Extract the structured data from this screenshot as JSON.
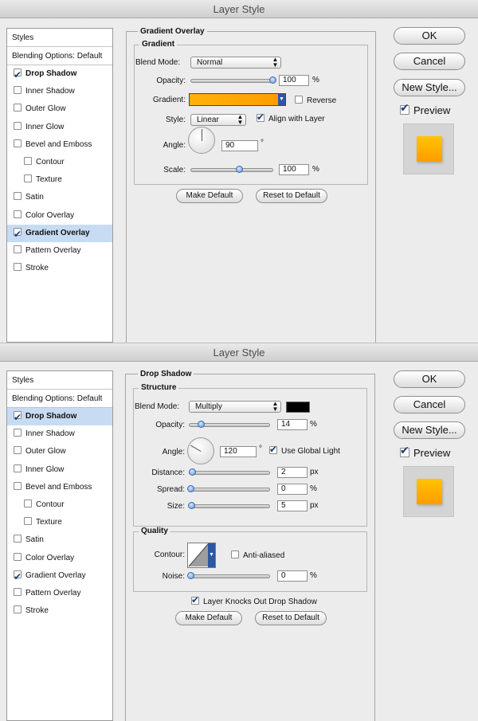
{
  "dialog1": {
    "title": "Layer Style",
    "styles_header": "Styles",
    "blending_options": "Blending Options: Default",
    "items": [
      {
        "label": "Drop Shadow",
        "checked": true
      },
      {
        "label": "Inner Shadow",
        "checked": false
      },
      {
        "label": "Outer Glow",
        "checked": false
      },
      {
        "label": "Inner Glow",
        "checked": false
      },
      {
        "label": "Bevel and Emboss",
        "checked": false
      },
      {
        "label": "Contour",
        "checked": false
      },
      {
        "label": "Texture",
        "checked": false
      },
      {
        "label": "Satin",
        "checked": false
      },
      {
        "label": "Color Overlay",
        "checked": false
      },
      {
        "label": "Gradient Overlay",
        "checked": true
      },
      {
        "label": "Pattern Overlay",
        "checked": false
      },
      {
        "label": "Stroke",
        "checked": false
      }
    ],
    "buttons": {
      "ok": "OK",
      "cancel": "Cancel",
      "new_style": "New Style...",
      "preview": "Preview"
    },
    "panel": {
      "section_title": "Gradient Overlay",
      "group_title": "Gradient",
      "blend_mode_label": "Blend Mode:",
      "blend_mode_value": "Normal",
      "opacity_label": "Opacity:",
      "opacity_value": "100",
      "opacity_unit": "%",
      "gradient_label": "Gradient:",
      "reverse_label": "Reverse",
      "style_label": "Style:",
      "style_value": "Linear",
      "align_label": "Align with Layer",
      "angle_label": "Angle:",
      "angle_value": "90",
      "angle_unit": "°",
      "scale_label": "Scale:",
      "scale_value": "100",
      "scale_unit": "%",
      "make_default": "Make Default",
      "reset_default": "Reset to Default"
    }
  },
  "dialog2": {
    "title": "Layer Style",
    "styles_header": "Styles",
    "blending_options": "Blending Options: Default",
    "items": [
      {
        "label": "Drop Shadow",
        "checked": true
      },
      {
        "label": "Inner Shadow",
        "checked": false
      },
      {
        "label": "Outer Glow",
        "checked": false
      },
      {
        "label": "Inner Glow",
        "checked": false
      },
      {
        "label": "Bevel and Emboss",
        "checked": false
      },
      {
        "label": "Contour",
        "checked": false
      },
      {
        "label": "Texture",
        "checked": false
      },
      {
        "label": "Satin",
        "checked": false
      },
      {
        "label": "Color Overlay",
        "checked": false
      },
      {
        "label": "Gradient Overlay",
        "checked": true
      },
      {
        "label": "Pattern Overlay",
        "checked": false
      },
      {
        "label": "Stroke",
        "checked": false
      }
    ],
    "buttons": {
      "ok": "OK",
      "cancel": "Cancel",
      "new_style": "New Style...",
      "preview": "Preview"
    },
    "panel": {
      "section_title": "Drop Shadow",
      "group_title": "Structure",
      "blend_mode_label": "Blend Mode:",
      "blend_mode_value": "Multiply",
      "opacity_label": "Opacity:",
      "opacity_value": "14",
      "opacity_unit": "%",
      "angle_label": "Angle:",
      "angle_value": "120",
      "angle_unit": "°",
      "global_light_label": "Use Global Light",
      "distance_label": "Distance:",
      "distance_value": "2",
      "distance_unit": "px",
      "spread_label": "Spread:",
      "spread_value": "0",
      "spread_unit": "%",
      "size_label": "Size:",
      "size_value": "5",
      "size_unit": "px",
      "quality_title": "Quality",
      "contour_label": "Contour:",
      "anti_aliased_label": "Anti-aliased",
      "noise_label": "Noise:",
      "noise_value": "0",
      "noise_unit": "%",
      "knockout_label": "Layer Knocks Out Drop Shadow",
      "make_default": "Make Default",
      "reset_default": "Reset to Default"
    }
  },
  "colors": {
    "gradient_start": "#ffb20b",
    "gradient_end": "#ff9c00",
    "shadow_color": "#000000",
    "selection": "#c7dcf3"
  }
}
